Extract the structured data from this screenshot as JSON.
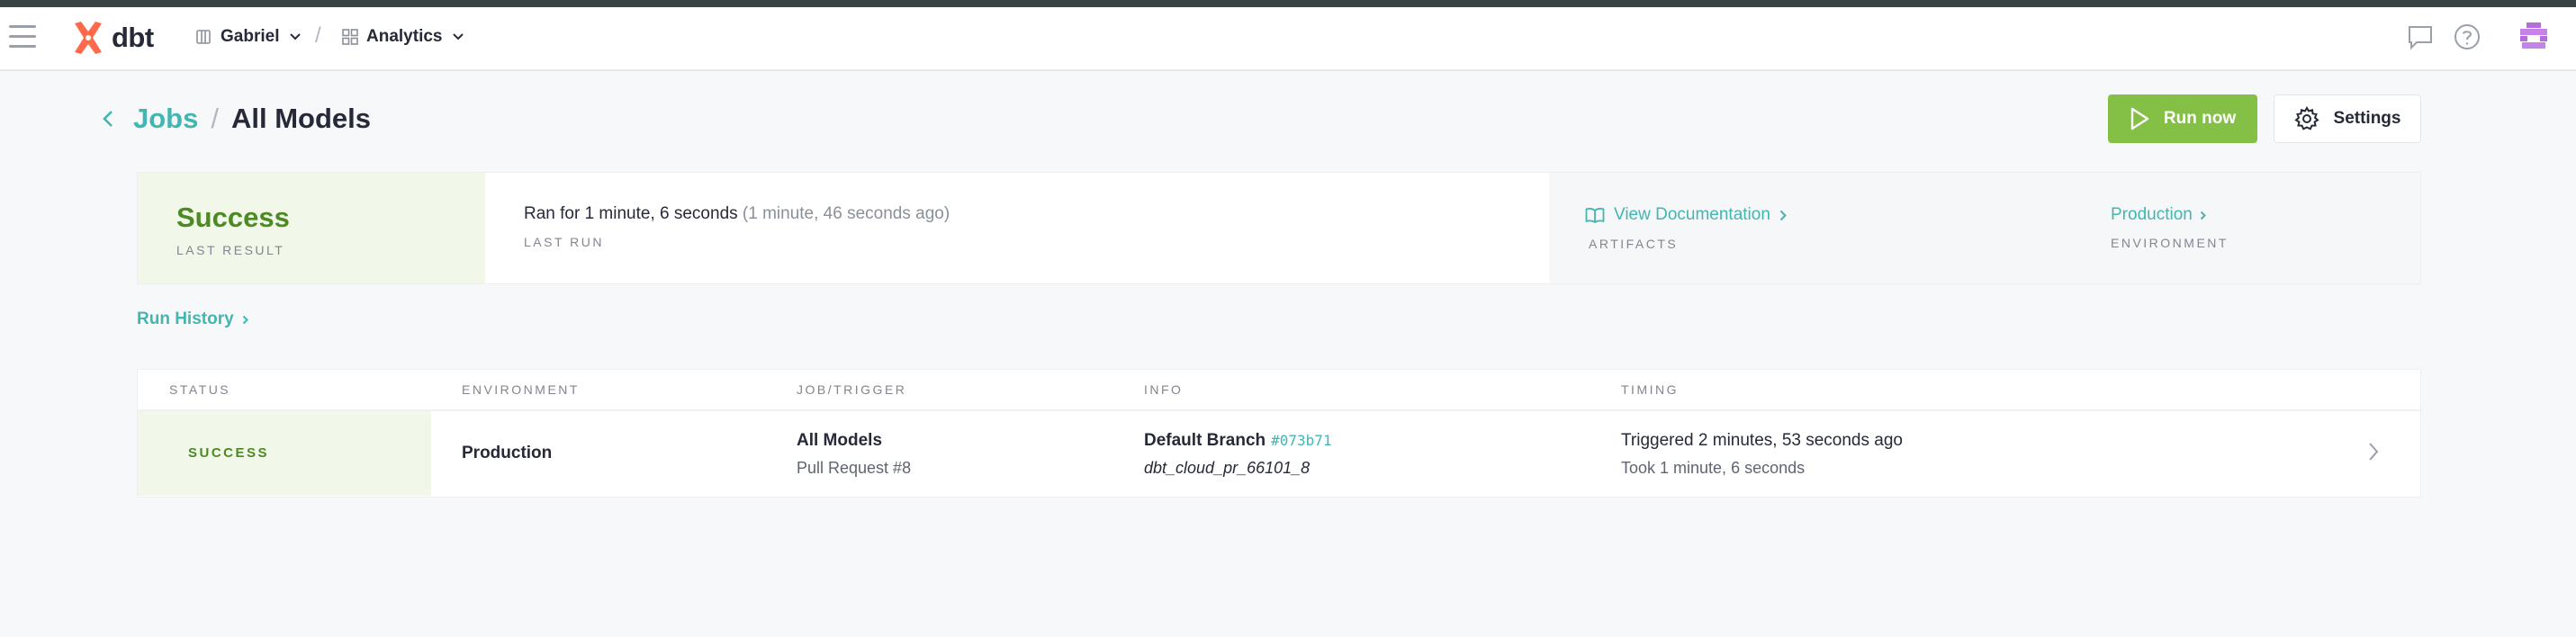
{
  "navbar": {
    "brand": "dbt",
    "account": "Gabriel",
    "separator": "/",
    "project": "Analytics",
    "icons": [
      "menu-icon",
      "dbt-logo-icon",
      "building-icon",
      "grid-icon",
      "chat-icon",
      "help-icon",
      "avatar"
    ]
  },
  "header": {
    "breadcrumb_parent": "Jobs",
    "breadcrumb_separator": "/",
    "title": "All Models",
    "run_now_label": "Run now",
    "settings_label": "Settings"
  },
  "summary": {
    "result": "Success",
    "result_caption": "LAST RESULT",
    "last_run_duration": "Ran for 1 minute, 6 seconds",
    "last_run_ago": "(1 minute, 46 seconds ago)",
    "last_run_caption": "LAST RUN",
    "documentation_link": "View Documentation",
    "artifacts_caption": "ARTIFACTS",
    "environment": "Production",
    "environment_caption": "ENVIRONMENT"
  },
  "run_history": {
    "label": "Run History",
    "columns": [
      "STATUS",
      "ENVIRONMENT",
      "JOB/TRIGGER",
      "INFO",
      "TIMING"
    ],
    "rows": [
      {
        "status": "SUCCESS",
        "environment": "Production",
        "job": "All Models",
        "trigger": "Pull Request #8",
        "branch_label": "Default Branch",
        "commit": "#073b71",
        "schema": "dbt_cloud_pr_66101_8",
        "triggered": "Triggered 2 minutes, 53 seconds ago",
        "took": "Took 1 minute, 6 seconds"
      }
    ]
  },
  "colors": {
    "accent": "#42b6b0",
    "brand": "#ff694a",
    "success_text": "#4d8a23",
    "success_bg": "#f1f7e9",
    "run_button": "#85c046"
  }
}
